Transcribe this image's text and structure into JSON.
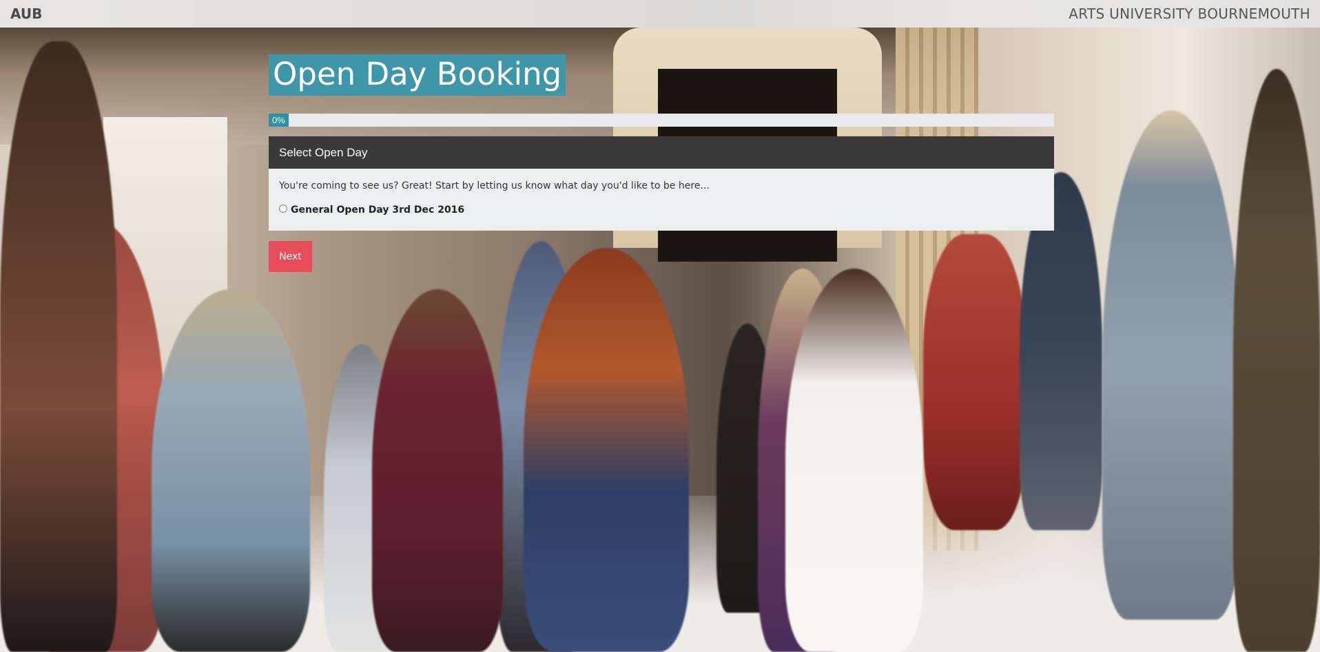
{
  "navbar": {
    "brand": "AUB",
    "title": "ARTS UNIVERSITY BOURNEMOUTH"
  },
  "page": {
    "title": "Open Day Booking"
  },
  "progress": {
    "value": 0,
    "label": "0%"
  },
  "panel": {
    "heading": "Select Open Day",
    "intro": "You're coming to see us? Great! Start by letting us know what day you'd like to be here...",
    "options": [
      {
        "label": "General Open Day 3rd Dec 2016",
        "selected": false
      }
    ]
  },
  "actions": {
    "next_label": "Next"
  },
  "colors": {
    "accent_teal": "#3e97a8",
    "progress_fill": "#2f8fa3",
    "panel_heading_bg": "#3a3a3a",
    "next_button": "#e74c5b"
  }
}
